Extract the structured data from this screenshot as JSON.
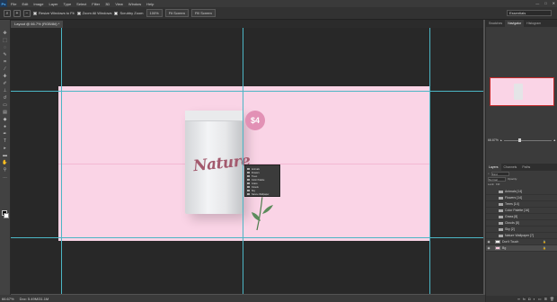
{
  "app": {
    "logo": "Ps",
    "menu": [
      "File",
      "Edit",
      "Image",
      "Layer",
      "Type",
      "Select",
      "Filter",
      "3D",
      "View",
      "Window",
      "Help"
    ],
    "window_controls": [
      "—",
      "□",
      "✕"
    ]
  },
  "options_bar": {
    "resize_windows": "Resize Windows to Fit",
    "zoom_all_windows": "Zoom All Windows",
    "scrubby_zoom": "Scrubby Zoom",
    "zoom_100": "100%",
    "fit_screen": "Fit Screen",
    "fill_screen": "Fill Screen",
    "workspace": "Essentials"
  },
  "document_tab": {
    "label": "Layout @ 66.7% (RGB/8#) *"
  },
  "canvas": {
    "price_label": "$4",
    "product_text": "Nature",
    "artboard_color": "#fad4e6",
    "badge_color": "#e291b5"
  },
  "context_menu": {
    "items": [
      "Animals",
      "Flowers",
      "Trees",
      "Color Palette",
      "Grass",
      "Clouds",
      "Sky",
      "Nature Wallpaper"
    ]
  },
  "status_bar": {
    "zoom": "66.67%",
    "doc_size": "Doc: 5.49M/31.1M"
  },
  "right_panel": {
    "top_tabs": [
      "Swatches",
      "Navigator",
      "Histogram"
    ],
    "zoom_value": "66.67%",
    "layer_tabs": [
      "Layers",
      "Channels",
      "Paths"
    ],
    "kind_label": "Kind",
    "normal_label": "Normal",
    "opacity_label": "Opacity:",
    "lock_label": "Lock:",
    "fill_label": "Fill:",
    "layers": [
      {
        "name": "Animals [14]",
        "type": "group",
        "visible": false
      },
      {
        "name": "Flowers [14]",
        "type": "group",
        "visible": false
      },
      {
        "name": "Trees [14]",
        "type": "group",
        "visible": false
      },
      {
        "name": "Color Palette [16]",
        "type": "group",
        "visible": false
      },
      {
        "name": "Grass [8]",
        "type": "group",
        "visible": false
      },
      {
        "name": "Clouds [8]",
        "type": "group",
        "visible": false
      },
      {
        "name": "Sky [2]",
        "type": "group",
        "visible": false
      },
      {
        "name": "Nature Wallpaper [7]",
        "type": "group",
        "visible": false
      },
      {
        "name": "Don't Touch",
        "type": "layer",
        "visible": true,
        "locked": true
      },
      {
        "name": "Bg",
        "type": "layer",
        "visible": true,
        "locked": true
      }
    ],
    "footer_icons": [
      "link-icon",
      "fx-icon",
      "mask-icon",
      "adjustment-icon",
      "folder-icon",
      "new-layer-icon",
      "trash-icon"
    ]
  }
}
